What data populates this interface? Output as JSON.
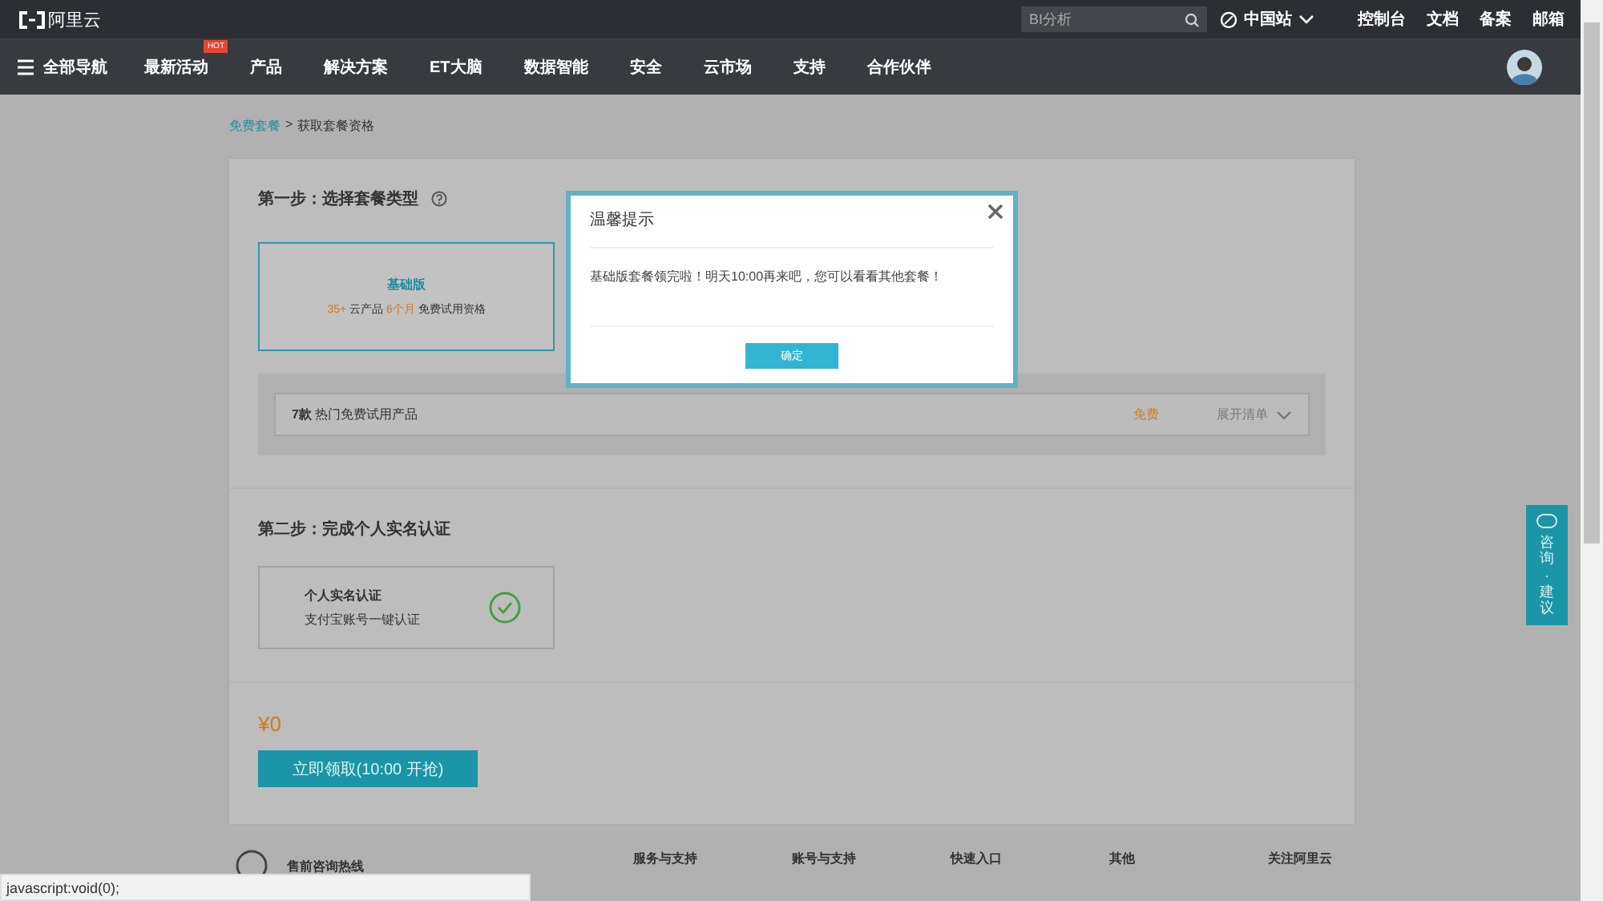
{
  "topbar": {
    "logo_text": "阿里云",
    "search": {
      "placeholder": "BI分析"
    },
    "region": "中国站",
    "links": [
      "控制台",
      "文档",
      "备案",
      "邮箱"
    ]
  },
  "nav": {
    "menu_label": "全部导航",
    "items": [
      {
        "label": "最新活动",
        "badge": "HOT"
      },
      {
        "label": "产品"
      },
      {
        "label": "解决方案"
      },
      {
        "label": "ET大脑"
      },
      {
        "label": "数据智能"
      },
      {
        "label": "安全"
      },
      {
        "label": "云市场"
      },
      {
        "label": "支持"
      },
      {
        "label": "合作伙伴"
      }
    ]
  },
  "breadcrumb": {
    "link": "免费套餐",
    "separator": ">",
    "current": "获取套餐资格"
  },
  "step1": {
    "title": "第一步：选择套餐类型",
    "plan": {
      "name": "基础版",
      "count": "35+",
      "count_label": "云产品",
      "duration": "6个月",
      "duration_label": "免费试用资格",
      "selected": true
    },
    "products": {
      "count": "7款",
      "label": "热门免费试用产品",
      "price": "免费",
      "toggle": "展开清单",
      "expanded": false
    }
  },
  "step2": {
    "title": "第二步：完成个人实名认证",
    "verify": {
      "title": "个人实名认证",
      "subtitle": "支付宝账号一键认证",
      "verified": true
    }
  },
  "price": "¥0",
  "claim_button": "立即领取(10:00 开抢)",
  "footer": {
    "hotline": "售前咨询热线",
    "columns": [
      "服务与支持",
      "账号与支持",
      "快速入口",
      "其他",
      "关注阿里云"
    ]
  },
  "dialog": {
    "title": "温馨提示",
    "message": "基础版套餐领完啦！明天10:00再来吧，您可以看看其他套餐！",
    "ok": "确定"
  },
  "feedback": {
    "labels": [
      "咨询",
      "建议"
    ],
    "separator": "·"
  },
  "status_bar": "javascript:void(0);"
}
